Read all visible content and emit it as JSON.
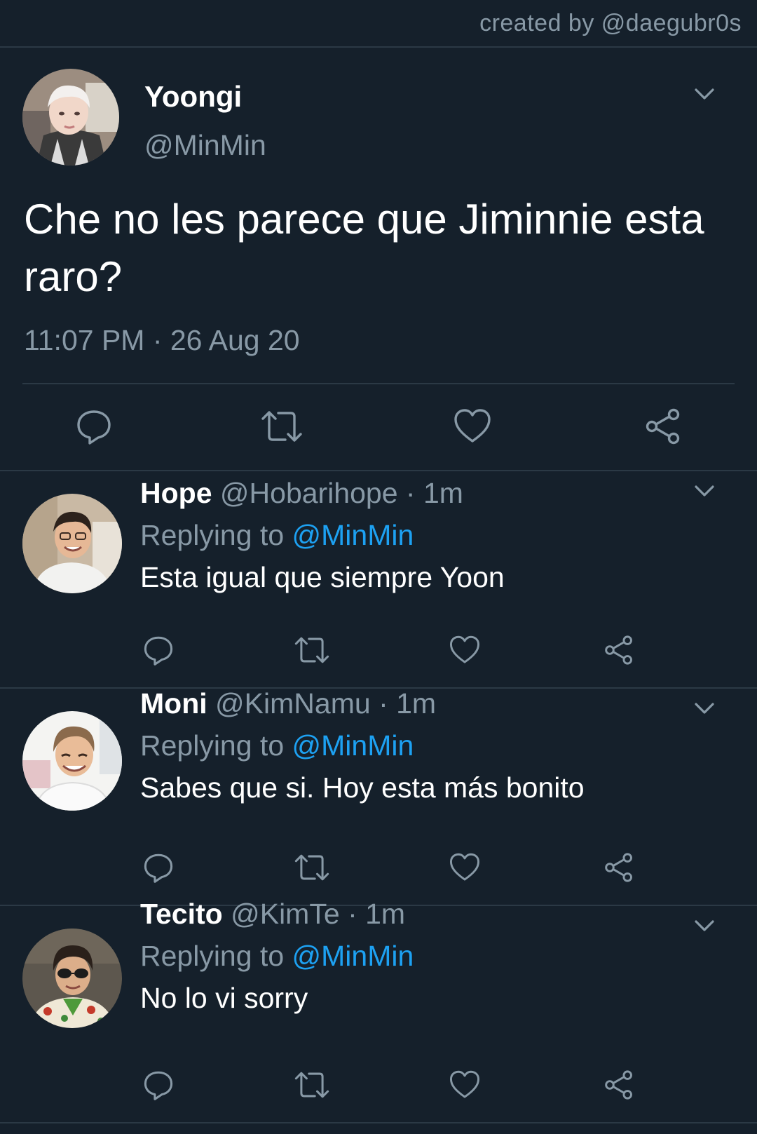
{
  "credit": "created by @daegubr0s",
  "main_tweet": {
    "name": "Yoongi",
    "handle": "@MinMin",
    "text": "Che no les parece que Jiminnie esta raro?",
    "timestamp": "11:07 PM · 26 Aug 20",
    "avatar_icon": "user-avatar-photo",
    "actions": [
      "reply-icon",
      "retweet-icon",
      "like-icon",
      "share-icon"
    ]
  },
  "replies": [
    {
      "name": "Hope",
      "handle": "@Hobarihope",
      "time": "· 1m",
      "replying_label": "Replying to",
      "replying_to": "@MinMin",
      "text": "Esta igual que siempre Yoon"
    },
    {
      "name": "Moni",
      "handle": "@KimNamu",
      "time": "· 1m",
      "replying_label": "Replying to",
      "replying_to": "@MinMin",
      "text": "Sabes que si. Hoy esta más bonito"
    },
    {
      "name": "Tecito",
      "handle": "@KimTe",
      "time": "· 1m",
      "replying_label": "Replying to",
      "replying_to": "@MinMin",
      "text": "No lo vi sorry"
    }
  ],
  "colors": {
    "background": "#15202b",
    "divider": "#2b3945",
    "secondary_text": "#8899a6",
    "mention": "#1da1f2",
    "primary_text": "#ffffff"
  }
}
